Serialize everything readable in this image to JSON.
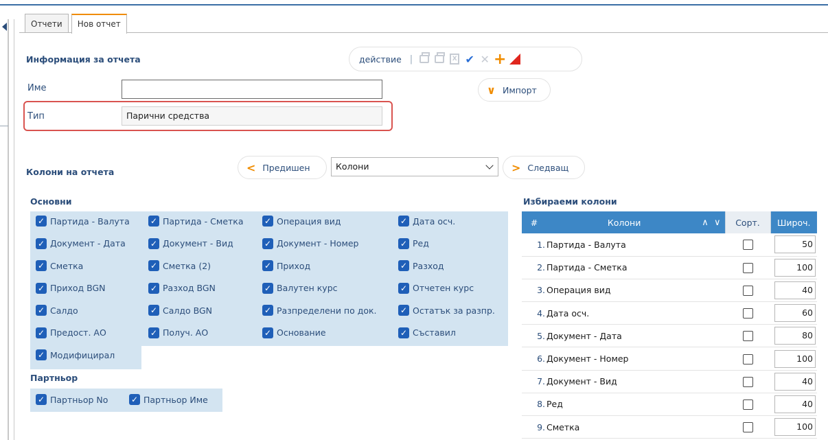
{
  "tabs": [
    {
      "label": "Отчети"
    },
    {
      "label": "Нов отчет"
    }
  ],
  "info": {
    "title": "Информация за отчета",
    "name_label": "Име",
    "name_value": "",
    "type_label": "Тип",
    "type_value": "Парични средства"
  },
  "toolbar": {
    "action_label": "действие",
    "separator": "|",
    "icons": [
      "print-icon",
      "print-all-icon",
      "excel-icon",
      "confirm-icon",
      "cancel-icon",
      "add-icon",
      "corner-flag-icon"
    ]
  },
  "import_label": "Импорт",
  "columns_section": {
    "title": "Колони на отчета",
    "prev_label": "Предишен",
    "select_value": "Колони",
    "next_label": "Следващ"
  },
  "groups": {
    "basic_title": "Основни",
    "basic": [
      [
        "Партида - Валута",
        "Партида - Сметка",
        "Операция вид",
        "Дата осч."
      ],
      [
        "Документ - Дата",
        "Документ - Вид",
        "Документ - Номер",
        "Ред"
      ],
      [
        "Сметка",
        "Сметка (2)",
        "Приход",
        "Разход"
      ],
      [
        "Приход BGN",
        "Разход BGN",
        "Валутен курс",
        "Отчетен курс"
      ],
      [
        "Салдо",
        "Салдо BGN",
        "Разпределени по док.",
        "Остатък за разпр."
      ],
      [
        "Предост. АО",
        "Получ. АО",
        "Основание",
        "Съставил"
      ],
      [
        "Модифицирал"
      ]
    ],
    "partner_title": "Партньор",
    "partner": [
      "Партньор No",
      "Партньор Име"
    ]
  },
  "selected": {
    "title": "Избираеми колони",
    "headers": {
      "num": "#",
      "col": "Колони",
      "sort": "Сорт.",
      "width": "Широч."
    },
    "rows": [
      {
        "n": "1.",
        "name": "Партида - Валута",
        "width": "50"
      },
      {
        "n": "2.",
        "name": "Партида - Сметка",
        "width": "100"
      },
      {
        "n": "3.",
        "name": "Операция вид",
        "width": "40"
      },
      {
        "n": "4.",
        "name": "Дата осч.",
        "width": "60"
      },
      {
        "n": "5.",
        "name": "Документ - Дата",
        "width": "80"
      },
      {
        "n": "6.",
        "name": "Документ - Номер",
        "width": "100"
      },
      {
        "n": "7.",
        "name": "Документ - Вид",
        "width": "40"
      },
      {
        "n": "8.",
        "name": "Ред",
        "width": "40"
      },
      {
        "n": "9.",
        "name": "Сметка",
        "width": "100"
      }
    ]
  },
  "colors": {
    "accent": "#f08c00",
    "primary": "#2b4d7a",
    "header_blue": "#3d87c6",
    "panel": "#d3e4f1",
    "highlight": "#d9534f"
  }
}
